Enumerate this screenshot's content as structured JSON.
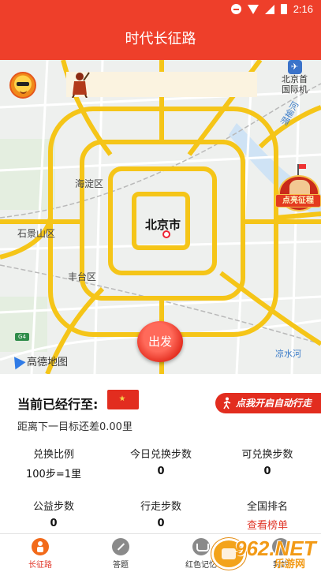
{
  "status_bar": {
    "time": "2:16"
  },
  "header": {
    "title": "时代长征路"
  },
  "map": {
    "districts": [
      "海淀区",
      "石景山区",
      "丰台区"
    ],
    "city": "北京市",
    "rivers": [
      "温榆河",
      "凉水河"
    ],
    "airport": {
      "badge": "✈",
      "name_line1": "北京首",
      "name_line2": "国际机"
    },
    "highway_badge": "G4",
    "provider": "高德地图",
    "badge_text": "点亮征程",
    "depart_label": "出发"
  },
  "progress": {
    "current_label": "当前已经行至:",
    "auto_walk_label": "点我开启自动行走",
    "distance_text": "距离下一目标还差0.00里",
    "stats": [
      {
        "label": "兑换比例",
        "value": "100步=1里"
      },
      {
        "label": "今日兑换步数",
        "value": "0"
      },
      {
        "label": "可兑换步数",
        "value": "0"
      },
      {
        "label": "公益步数",
        "value": "0"
      },
      {
        "label": "行走步数",
        "value": "0"
      },
      {
        "label": "全国排名",
        "link": "查看榜单"
      }
    ]
  },
  "nav": [
    {
      "label": "长征路",
      "active": true
    },
    {
      "label": "答题",
      "active": false
    },
    {
      "label": "红色记忆",
      "active": false
    },
    {
      "label": "我的",
      "active": false
    }
  ],
  "watermark": {
    "big": "962.NET",
    "small": "乐游网"
  },
  "colors": {
    "primary": "#ee3f2a",
    "road_major": "#f5c518",
    "road_minor": "#ffffff",
    "accent_link": "#e0372a"
  }
}
